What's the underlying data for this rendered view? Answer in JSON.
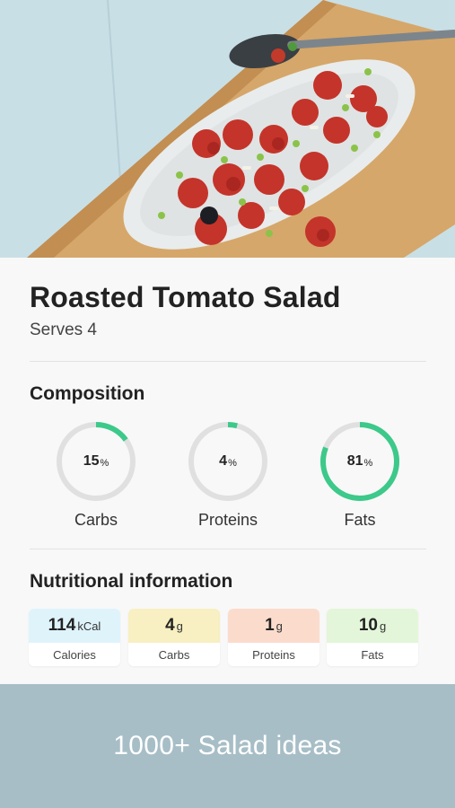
{
  "recipe": {
    "title": "Roasted Tomato Salad",
    "serves": "Serves 4"
  },
  "composition": {
    "heading": "Composition",
    "items": [
      {
        "label": "Carbs",
        "value": "15",
        "unit": "%",
        "percent": 15
      },
      {
        "label": "Proteins",
        "value": "4",
        "unit": "%",
        "percent": 4
      },
      {
        "label": "Fats",
        "value": "81",
        "unit": "%",
        "percent": 81
      }
    ],
    "ring_color": "#3cc98a",
    "track_color": "#e0e0e0"
  },
  "nutrition": {
    "heading": "Nutritional information",
    "items": [
      {
        "label": "Calories",
        "value": "114",
        "unit": "kCal",
        "color": "#dff3fb"
      },
      {
        "label": "Carbs",
        "value": "4",
        "unit": "g",
        "color": "#f8efc2"
      },
      {
        "label": "Proteins",
        "value": "1",
        "unit": "g",
        "color": "#fbdccc"
      },
      {
        "label": "Fats",
        "value": "10",
        "unit": "g",
        "color": "#e3f6d9"
      }
    ]
  },
  "footer": {
    "text": "1000+ Salad ideas",
    "background": "#a7bec6"
  },
  "hero": {
    "image_icon": "tomato-salad-photo"
  }
}
